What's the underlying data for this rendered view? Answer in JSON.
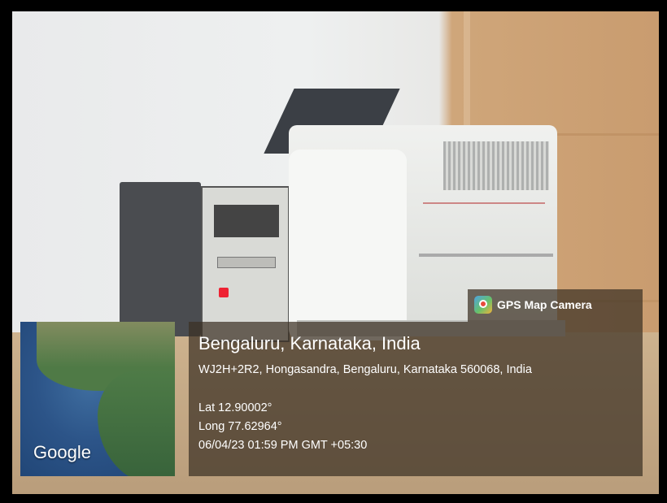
{
  "badge": {
    "title": "GPS Map Camera",
    "icon": "gps-map-camera-app-icon"
  },
  "map": {
    "attribution": "Google"
  },
  "location": {
    "place": "Bengaluru, Karnataka, India",
    "address": "WJ2H+2R2, Hongasandra, Bengaluru, Karnataka 560068, India",
    "latitude": "Lat 12.90002°",
    "longitude": "Long 77.62964°",
    "datetime": "06/04/23 01:59 PM GMT +05:30"
  }
}
